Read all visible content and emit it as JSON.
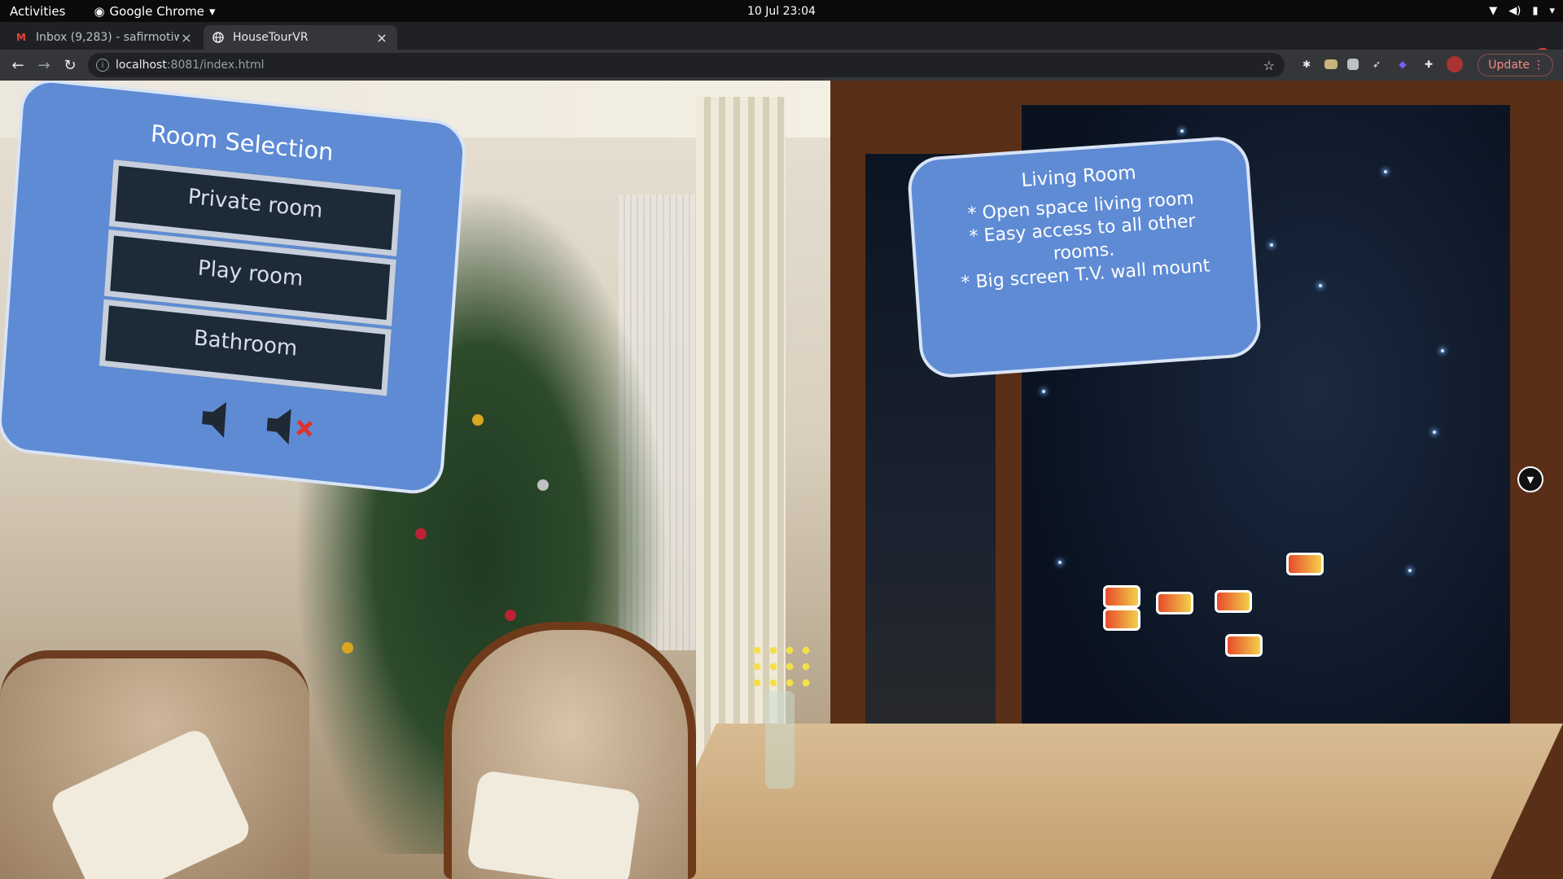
{
  "system": {
    "activities": "Activities",
    "app_name": "Google Chrome",
    "clock": "10 Jul  23:04"
  },
  "tabs": [
    {
      "title": "Inbox (9,283) - safirmotiw",
      "icon": "gmail-icon"
    },
    {
      "title": "HouseTourVR",
      "icon": "globe-icon"
    }
  ],
  "toolbar": {
    "url_host": "localhost",
    "url_path": ":8081/index.html",
    "update_label": "Update"
  },
  "room_selection": {
    "title": "Room Selection",
    "buttons": [
      "Private room",
      "Play room",
      "Bathroom"
    ],
    "sound_on_icon": "speaker-icon",
    "sound_off_icon": "speaker-muted-icon"
  },
  "room_info": {
    "title": "Living Room",
    "lines": [
      "* Open space living room",
      "* Easy access to all other",
      "rooms.",
      "* Big screen T.V. wall  mount"
    ]
  },
  "colors": {
    "panel_blue": "#5e8bd4",
    "button_dark": "#1d2a38",
    "update_red": "#f28b82"
  }
}
